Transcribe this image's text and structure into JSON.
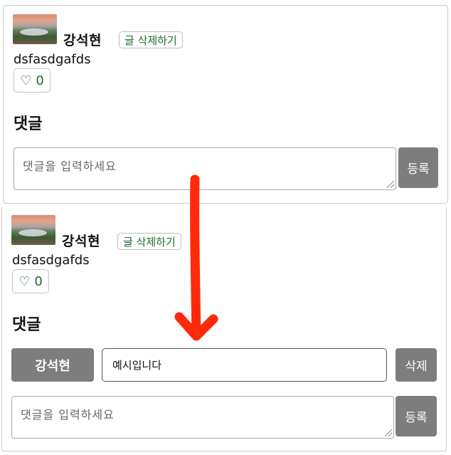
{
  "post1": {
    "author": "강석현",
    "delete_label": "글 삭제하기",
    "content": "dsfasdgafds",
    "like_icon": "♡",
    "like_count": "0",
    "comments_title": "댓글",
    "comment_placeholder": "댓글을  입력하세요",
    "submit_label": "등록"
  },
  "post2": {
    "author": "강석현",
    "delete_label": "글 삭제하기",
    "content": "dsfasdgafds",
    "like_icon": "♡",
    "like_count": "0",
    "comments_title": "댓글",
    "comments": [
      {
        "author": "강석현",
        "text": "예시입니다",
        "delete_label": "삭제"
      }
    ],
    "comment_placeholder": "댓글을  입력하세요",
    "submit_label": "등록"
  },
  "colors": {
    "annotation_arrow": "#ff2a0a",
    "button_gray": "#7d7d7d",
    "link_green": "#1e6b2a"
  }
}
